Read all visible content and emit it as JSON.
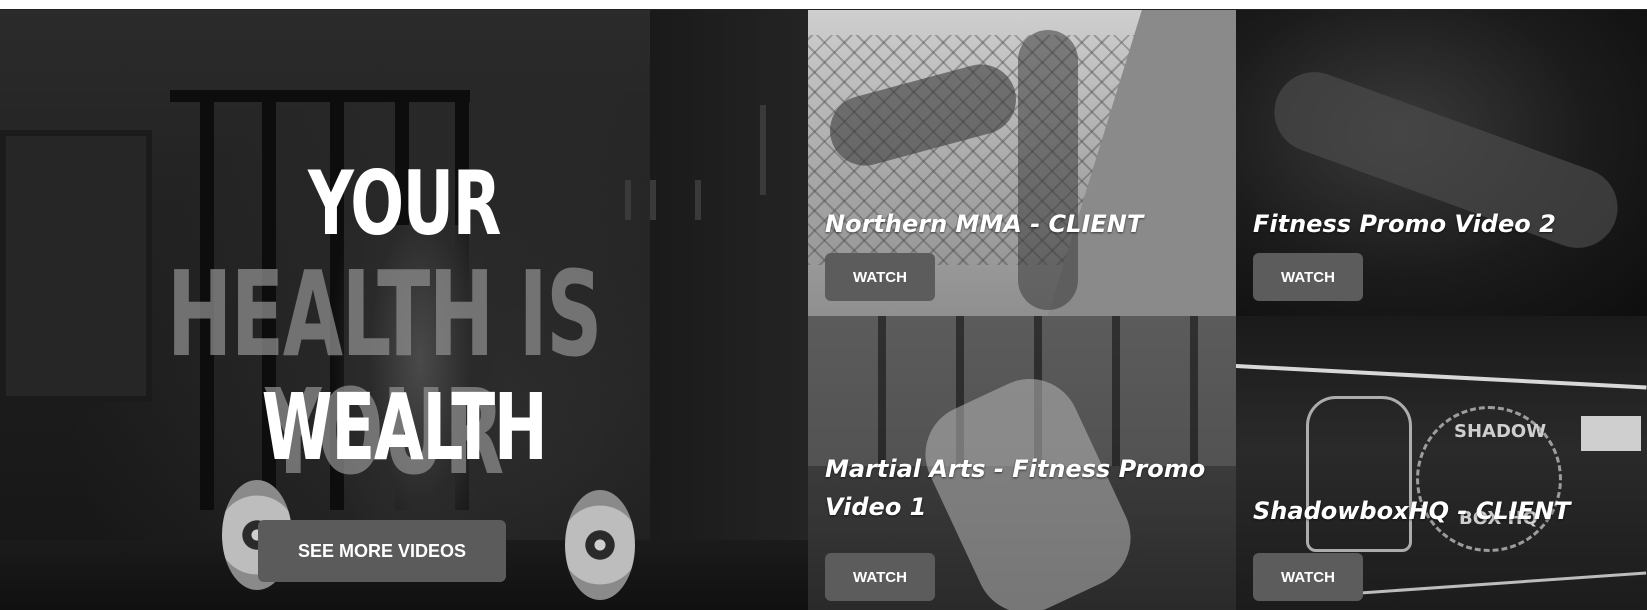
{
  "hero": {
    "line1": "YOUR",
    "line2": "HEALTH IS YOUR",
    "line3": "WEALTH",
    "cta_label": "SEE MORE VIDEOS"
  },
  "tiles": [
    {
      "title": "Northern MMA - CLIENT",
      "watch_label": "WATCH"
    },
    {
      "title": "Fitness Promo Video 2",
      "watch_label": "WATCH"
    },
    {
      "title_line1": "Martial Arts - Fitness Promo",
      "title_line2": "Video 1",
      "watch_label": "WATCH"
    },
    {
      "title": "ShadowboxHQ - CLIENT",
      "watch_label": "WATCH",
      "logo_top": "SHADOW",
      "logo_bottom": "BOX HQ"
    }
  ],
  "colors": {
    "button_bg": "#5c5c5c",
    "text": "#ffffff",
    "hero_dim_text": "#8c8c8c"
  }
}
